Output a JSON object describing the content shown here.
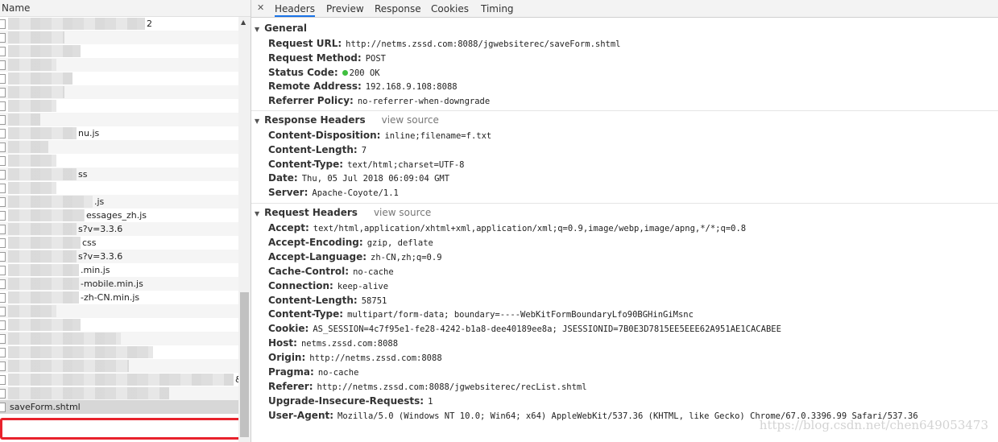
{
  "list": {
    "header": "Name",
    "items": [
      {
        "suffix": "2",
        "blur": 170
      },
      {
        "suffix": "",
        "blur": 70
      },
      {
        "suffix": "",
        "blur": 90
      },
      {
        "suffix": "",
        "blur": 60
      },
      {
        "suffix": "",
        "blur": 80
      },
      {
        "suffix": "",
        "blur": 70
      },
      {
        "suffix": "",
        "blur": 60
      },
      {
        "suffix": "",
        "blur": 40
      },
      {
        "suffix": "nu.js",
        "blur": 85
      },
      {
        "suffix": "",
        "blur": 50
      },
      {
        "suffix": "",
        "blur": 60
      },
      {
        "suffix": "ss",
        "blur": 85
      },
      {
        "suffix": "",
        "blur": 60
      },
      {
        "suffix": ".js",
        "blur": 105
      },
      {
        "suffix": "essages_zh.js",
        "blur": 95
      },
      {
        "suffix": "s?v=3.3.6",
        "blur": 85
      },
      {
        "suffix": "css",
        "blur": 90
      },
      {
        "suffix": "s?v=3.3.6",
        "blur": 85
      },
      {
        "suffix": ".min.js",
        "blur": 88
      },
      {
        "suffix": "-mobile.min.js",
        "blur": 88
      },
      {
        "suffix": "-zh-CN.min.js",
        "blur": 88
      },
      {
        "suffix": "",
        "blur": 60
      },
      {
        "suffix": "",
        "blur": 90
      },
      {
        "suffix": "",
        "blur": 140
      },
      {
        "suffix": "",
        "blur": 180
      },
      {
        "suffix": "",
        "blur": 150
      },
      {
        "suffix": "&",
        "blur": 280
      },
      {
        "suffix": "",
        "blur": 200
      }
    ],
    "selected": "saveForm.shtml"
  },
  "tabs": [
    "Headers",
    "Preview",
    "Response",
    "Cookies",
    "Timing"
  ],
  "close_icon": "✕",
  "general": {
    "title": "General",
    "rows": [
      {
        "k": "Request URL:",
        "v": "http://netms.zssd.com:8088/jgwebsiterec/saveForm.shtml"
      },
      {
        "k": "Request Method:",
        "v": "POST"
      },
      {
        "k": "Status Code:",
        "v": "200 OK"
      },
      {
        "k": "Remote Address:",
        "v": "192.168.9.108:8088"
      },
      {
        "k": "Referrer Policy:",
        "v": "no-referrer-when-downgrade"
      }
    ]
  },
  "response_headers": {
    "title": "Response Headers",
    "view_source": "view source",
    "rows": [
      {
        "k": "Content-Disposition:",
        "v": "inline;filename=f.txt"
      },
      {
        "k": "Content-Length:",
        "v": "7"
      },
      {
        "k": "Content-Type:",
        "v": "text/html;charset=UTF-8"
      },
      {
        "k": "Date:",
        "v": "Thu, 05 Jul 2018 06:09:04 GMT"
      },
      {
        "k": "Server:",
        "v": "Apache-Coyote/1.1"
      }
    ]
  },
  "request_headers": {
    "title": "Request Headers",
    "view_source": "view source",
    "rows": [
      {
        "k": "Accept:",
        "v": "text/html,application/xhtml+xml,application/xml;q=0.9,image/webp,image/apng,*/*;q=0.8"
      },
      {
        "k": "Accept-Encoding:",
        "v": "gzip, deflate"
      },
      {
        "k": "Accept-Language:",
        "v": "zh-CN,zh;q=0.9"
      },
      {
        "k": "Cache-Control:",
        "v": "no-cache"
      },
      {
        "k": "Connection:",
        "v": "keep-alive"
      },
      {
        "k": "Content-Length:",
        "v": "58751"
      },
      {
        "k": "Content-Type:",
        "v": "multipart/form-data; boundary=----WebKitFormBoundaryLfo90BGHinGiMsnc"
      },
      {
        "k": "Cookie:",
        "v": "AS_SESSION=4c7f95e1-fe28-4242-b1a8-dee40189ee8a; JSESSIONID=7B0E3D7815EE5EEE62A951AE1CACABEE"
      },
      {
        "k": "Host:",
        "v": "netms.zssd.com:8088"
      },
      {
        "k": "Origin:",
        "v": "http://netms.zssd.com:8088"
      },
      {
        "k": "Pragma:",
        "v": "no-cache"
      },
      {
        "k": "Referer:",
        "v": "http://netms.zssd.com:8088/jgwebsiterec/recList.shtml"
      },
      {
        "k": "Upgrade-Insecure-Requests:",
        "v": "1"
      },
      {
        "k": "User-Agent:",
        "v": "Mozilla/5.0 (Windows NT 10.0; Win64; x64) AppleWebKit/537.36 (KHTML, like Gecko) Chrome/67.0.3396.99 Safari/537.36"
      }
    ]
  },
  "colors": {
    "status_ok": "#3fbf3f",
    "highlight": "#e8222c",
    "tab_active": "#1a73e8"
  },
  "watermark": "https://blog.csdn.net/chen649053473"
}
